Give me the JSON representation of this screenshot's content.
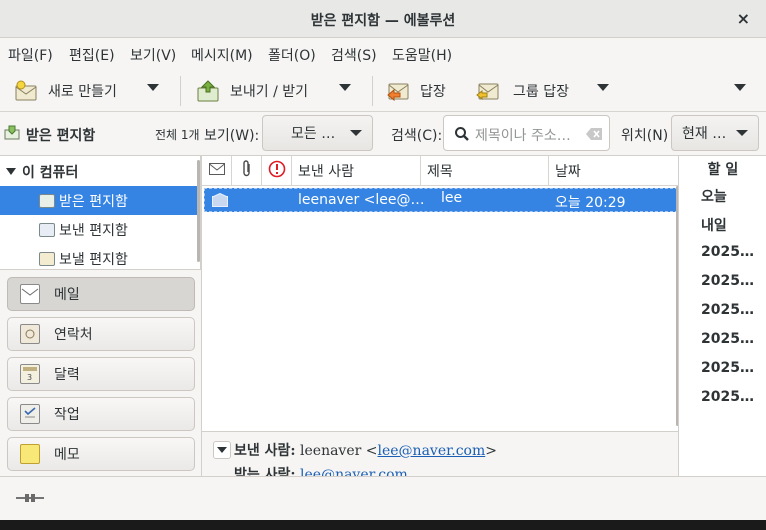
{
  "window": {
    "title": "받은 편지함 — 에볼루션",
    "close_glyph": "×"
  },
  "menu": [
    "파일(F)",
    "편집(E)",
    "보기(V)",
    "메시지(M)",
    "폴더(O)",
    "검색(S)",
    "도움말(H)"
  ],
  "toolbar": {
    "new_label": "새로 만들기",
    "send_receive_label": "보내기 / 받기",
    "reply_label": "답장",
    "group_reply_label": "그룹 답장"
  },
  "searchbar": {
    "folder_name": "받은 편지함",
    "total_count": "전체 1개",
    "view_label": "보기(W):",
    "view_value": "모든 …",
    "search_label": "검색(C):",
    "search_placeholder": "제목이나 주소…",
    "location_label": "위치(N)",
    "location_value": "현재 …"
  },
  "folders": {
    "root": "이 컴퓨터",
    "items": [
      "받은 편지함",
      "보낸 편지함",
      "보낼 편지함"
    ]
  },
  "switcher": [
    "메일",
    "연락처",
    "달력",
    "작업",
    "메모"
  ],
  "message_list": {
    "columns": {
      "from": "보낸 사람",
      "subject": "제목",
      "date": "날짜"
    },
    "rows": [
      {
        "from": "leenaver <lee@…",
        "subject": "lee",
        "date": "오늘 20:29"
      }
    ]
  },
  "preview": {
    "from_label": "보낸 사람:",
    "from_name": "leenaver <",
    "from_email": "lee@naver.com",
    "from_close": ">",
    "to_label": "받는 사람:",
    "to_email": "lee@naver.com"
  },
  "todo": {
    "header": "할 일",
    "items": [
      "오늘",
      "내일",
      "2025…",
      "2025…",
      "2025…",
      "2025…",
      "2025…",
      "2025…"
    ]
  },
  "colors": {
    "selection": "#3584e4",
    "link": "#1a5fb4",
    "important": "#e01b24"
  }
}
